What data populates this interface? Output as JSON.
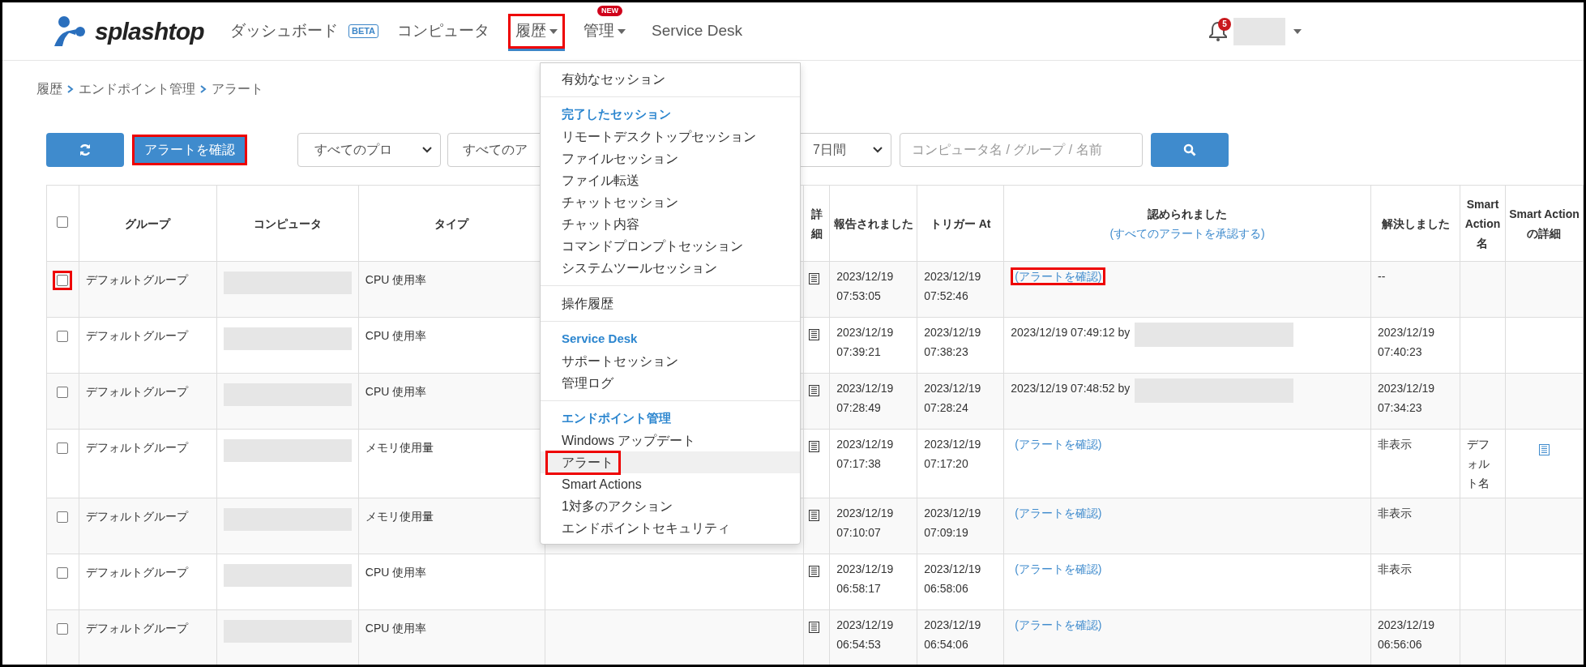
{
  "header": {
    "logo": "splashtop",
    "nav": [
      {
        "label": "ダッシュボード",
        "selected": false,
        "highlighted": false,
        "caret": false,
        "badge": {
          "kind": "outline",
          "text": "BETA"
        }
      },
      {
        "label": "コンピュータ",
        "selected": false,
        "highlighted": false,
        "caret": false
      },
      {
        "label": "履歴",
        "selected": true,
        "highlighted": true,
        "caret": true
      },
      {
        "label": "管理",
        "selected": false,
        "highlighted": false,
        "caret": true,
        "badge": {
          "kind": "pill",
          "text": "NEW"
        }
      },
      {
        "label": "Service Desk",
        "selected": false,
        "highlighted": false,
        "caret": false
      }
    ],
    "notifications": {
      "count": "5"
    }
  },
  "breadcrumb": [
    "履歴",
    "エンドポイント管理",
    "アラート"
  ],
  "toolbar": {
    "acknowledge_button": {
      "label": "アラートを確認",
      "highlighted": true
    },
    "filters": [
      "すべてのプロ",
      "すべてのア",
      "7日間"
    ],
    "search": {
      "placeholder": "コンピュータ名 / グループ / 名前"
    }
  },
  "table": {
    "select_all": {
      "checked": false
    },
    "columns": [
      {
        "label": "グループ"
      },
      {
        "label": "コンピュータ"
      },
      {
        "label": "タイプ"
      },
      {
        "label": "詳細"
      },
      {
        "label": "報告されました"
      },
      {
        "label": "トリガー At"
      },
      {
        "label": "認められました",
        "link": "(すべてのアラートを承認する)"
      },
      {
        "label": "解決しました"
      },
      {
        "label": "Smart Action 名"
      },
      {
        "label": "Smart Action の詳細"
      }
    ],
    "rows": [
      {
        "checked": false,
        "highlighted": true,
        "group": "デフォルトグループ",
        "type": "CPU 使用率",
        "reported": "2023/12/19 07:53:05",
        "triggered": "2023/12/19 07:52:46",
        "acknowledged": {
          "kind": "link",
          "text": "(アラートを確認)",
          "highlighted": true
        },
        "resolved": "--",
        "smart_action_detail": false
      },
      {
        "checked": false,
        "highlighted": false,
        "group": "デフォルトグループ",
        "type": "CPU 使用率",
        "reported": "2023/12/19 07:39:21",
        "triggered": "2023/12/19 07:38:23",
        "acknowledged": {
          "kind": "by",
          "text": "2023/12/19 07:49:12 by"
        },
        "resolved": "2023/12/19 07:40:23",
        "smart_action_detail": false
      },
      {
        "checked": false,
        "highlighted": false,
        "group": "デフォルトグループ",
        "type": "CPU 使用率",
        "reported": "2023/12/19 07:28:49",
        "triggered": "2023/12/19 07:28:24",
        "acknowledged": {
          "kind": "by",
          "text": "2023/12/19 07:48:52 by"
        },
        "resolved": "2023/12/19 07:34:23",
        "smart_action_detail": false
      },
      {
        "checked": false,
        "highlighted": false,
        "group": "デフォルトグループ",
        "type": "メモリ使用量",
        "reported": "2023/12/19 07:17:38",
        "triggered": "2023/12/19 07:17:20",
        "acknowledged": {
          "kind": "link",
          "text": "(アラートを確認)",
          "highlighted": false
        },
        "resolved": "非表示",
        "smart_action_name": "デフォルト名",
        "smart_action_detail": true
      },
      {
        "checked": false,
        "highlighted": false,
        "group": "デフォルトグループ",
        "type": "メモリ使用量",
        "reported": "2023/12/19 07:10:07",
        "triggered": "2023/12/19 07:09:19",
        "acknowledged": {
          "kind": "link",
          "text": "(アラートを確認)",
          "highlighted": false
        },
        "resolved": "非表示",
        "smart_action_detail": false
      },
      {
        "checked": false,
        "highlighted": false,
        "group": "デフォルトグループ",
        "type": "CPU 使用率",
        "reported": "2023/12/19 06:58:17",
        "triggered": "2023/12/19 06:58:06",
        "acknowledged": {
          "kind": "link",
          "text": "(アラートを確認)",
          "highlighted": false
        },
        "resolved": "非表示",
        "smart_action_detail": false
      },
      {
        "checked": false,
        "highlighted": false,
        "group": "デフォルトグループ",
        "type": "CPU 使用率",
        "reported": "2023/12/19 06:54:53",
        "triggered": "2023/12/19 06:54:06",
        "acknowledged": {
          "kind": "link",
          "text": "(アラートを確認)",
          "highlighted": false
        },
        "resolved": "2023/12/19 06:56:06",
        "smart_action_detail": false
      }
    ]
  },
  "menu": {
    "items": [
      {
        "kind": "item",
        "label": "有効なセッション",
        "selected": false,
        "highlighted": false
      },
      {
        "kind": "divider"
      },
      {
        "kind": "heading",
        "label": "完了したセッション"
      },
      {
        "kind": "item",
        "label": "リモートデスクトップセッション",
        "selected": false,
        "highlighted": false
      },
      {
        "kind": "item",
        "label": "ファイルセッション",
        "selected": false,
        "highlighted": false
      },
      {
        "kind": "item",
        "label": "ファイル転送",
        "selected": false,
        "highlighted": false
      },
      {
        "kind": "item",
        "label": "チャットセッション",
        "selected": false,
        "highlighted": false
      },
      {
        "kind": "item",
        "label": "チャット内容",
        "selected": false,
        "highlighted": false
      },
      {
        "kind": "item",
        "label": "コマンドプロンプトセッション",
        "selected": false,
        "highlighted": false
      },
      {
        "kind": "item",
        "label": "システムツールセッション",
        "selected": false,
        "highlighted": false
      },
      {
        "kind": "divider"
      },
      {
        "kind": "item",
        "label": "操作履歴",
        "selected": false,
        "highlighted": false
      },
      {
        "kind": "divider"
      },
      {
        "kind": "heading",
        "label": "Service Desk"
      },
      {
        "kind": "item",
        "label": "サポートセッション",
        "selected": false,
        "highlighted": false
      },
      {
        "kind": "item",
        "label": "管理ログ",
        "selected": false,
        "highlighted": false
      },
      {
        "kind": "divider"
      },
      {
        "kind": "heading",
        "label": "エンドポイント管理"
      },
      {
        "kind": "item",
        "label": "Windows アップデート",
        "selected": false,
        "highlighted": false
      },
      {
        "kind": "item",
        "label": "アラート",
        "selected": true,
        "highlighted": true
      },
      {
        "kind": "item",
        "label": "Smart Actions",
        "selected": false,
        "highlighted": false
      },
      {
        "kind": "item",
        "label": "1対多のアクション",
        "selected": false,
        "highlighted": false
      },
      {
        "kind": "item",
        "label": "エンドポイントセキュリティ",
        "selected": false,
        "highlighted": false
      }
    ]
  }
}
